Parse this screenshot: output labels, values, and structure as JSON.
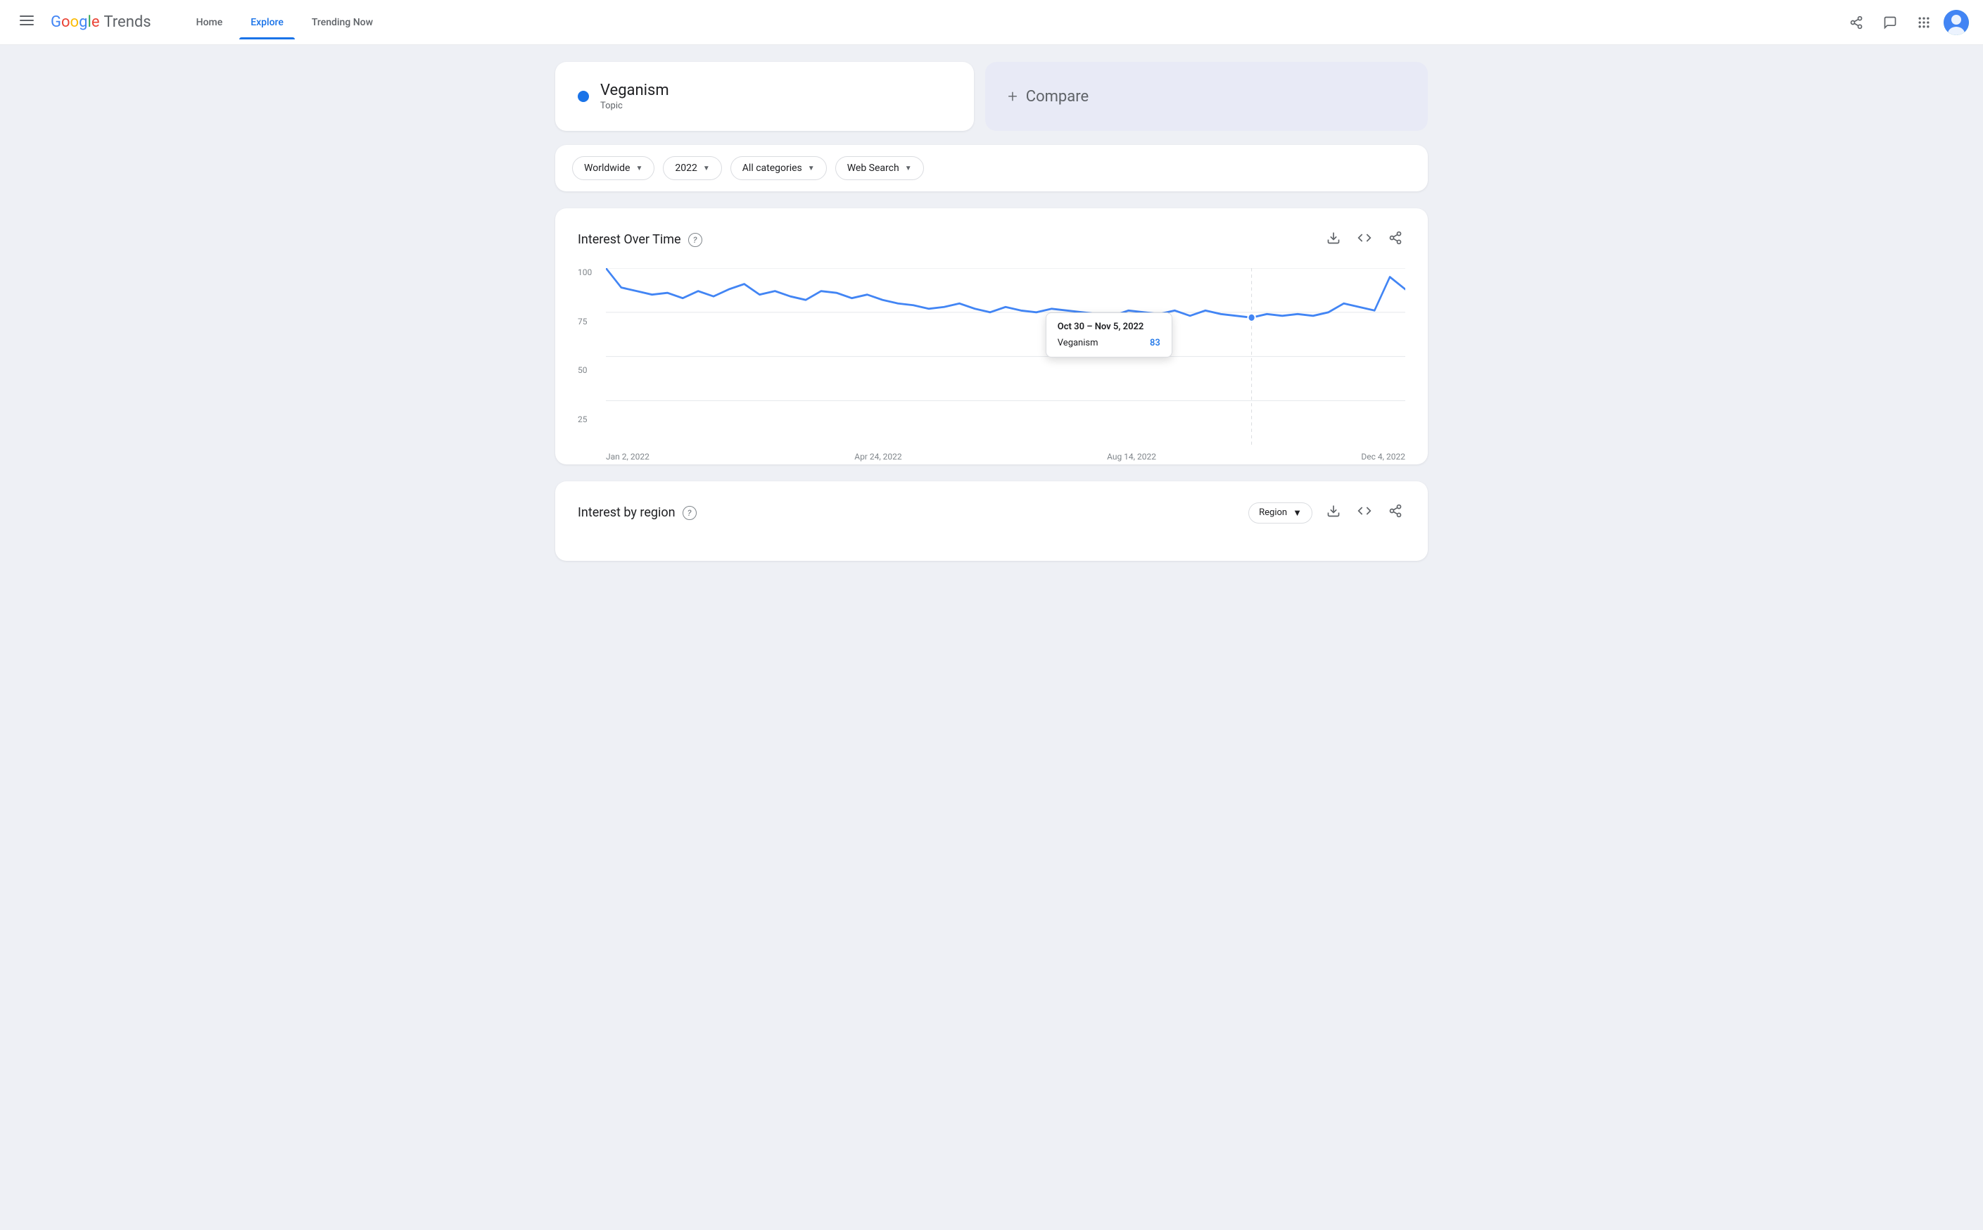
{
  "header": {
    "hamburger_label": "☰",
    "logo": {
      "google": "Google",
      "trends": "Trends"
    },
    "nav": [
      {
        "id": "home",
        "label": "Home",
        "active": false
      },
      {
        "id": "explore",
        "label": "Explore",
        "active": true
      },
      {
        "id": "trending",
        "label": "Trending Now",
        "active": false
      }
    ],
    "share_icon": "⤢",
    "feedback_icon": "💬",
    "apps_icon": "⣿"
  },
  "search": {
    "topic_name": "Veganism",
    "topic_type": "Topic",
    "compare_label": "Compare"
  },
  "filters": [
    {
      "id": "region",
      "label": "Worldwide"
    },
    {
      "id": "year",
      "label": "2022"
    },
    {
      "id": "category",
      "label": "All categories"
    },
    {
      "id": "search_type",
      "label": "Web Search"
    }
  ],
  "interest_over_time": {
    "title": "Interest Over Time",
    "help_text": "?",
    "y_labels": [
      "100",
      "75",
      "50",
      "25"
    ],
    "x_labels": [
      "Jan 2, 2022",
      "Apr 24, 2022",
      "Aug 14, 2022",
      "Dec 4, 2022"
    ],
    "tooltip": {
      "date": "Oct 30 – Nov 5, 2022",
      "term": "Veganism",
      "value": "83"
    },
    "chart_data": [
      100,
      89,
      87,
      85,
      86,
      83,
      87,
      84,
      88,
      91,
      85,
      87,
      84,
      82,
      87,
      86,
      83,
      85,
      82,
      80,
      79,
      77,
      78,
      80,
      77,
      75,
      78,
      76,
      75,
      77,
      76,
      75,
      74,
      73,
      76,
      75,
      74,
      76,
      73,
      76,
      74,
      73,
      72,
      74,
      73,
      74,
      73,
      75,
      80,
      78,
      76,
      95,
      88
    ]
  },
  "interest_by_region": {
    "title": "Interest by region",
    "help_text": "?",
    "region_selector_label": "Region"
  },
  "actions": {
    "download_icon": "↓",
    "embed_icon": "<>",
    "share_icon": "⤢"
  }
}
